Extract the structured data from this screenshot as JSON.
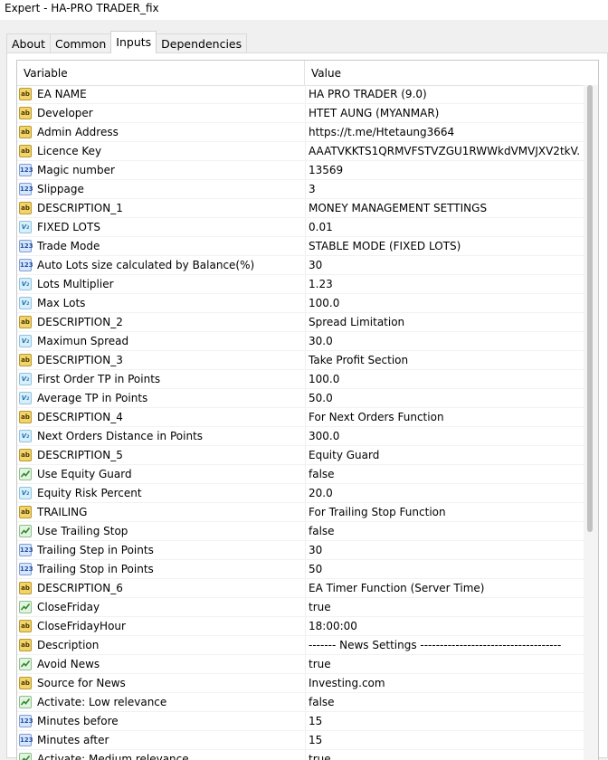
{
  "window": {
    "title": "Expert - HA-PRO TRADER_fix"
  },
  "tabs": [
    {
      "label": "About"
    },
    {
      "label": "Common"
    },
    {
      "label": "Inputs"
    },
    {
      "label": "Dependencies"
    }
  ],
  "active_tab": "Inputs",
  "table": {
    "columns": {
      "variable": "Variable",
      "value": "Value"
    },
    "rows": [
      {
        "type": "string",
        "icon": "string-icon",
        "variable": "EA NAME",
        "value": "HA PRO TRADER (9.0)"
      },
      {
        "type": "string",
        "icon": "string-icon",
        "variable": "Developer",
        "value": "HTET AUNG (MYANMAR)"
      },
      {
        "type": "string",
        "icon": "string-icon",
        "variable": "Admin Address",
        "value": "https://t.me/Htetaung3664"
      },
      {
        "type": "string",
        "icon": "string-icon",
        "variable": "Licence Key",
        "value": "AAATVKKTS1QRMVFSTVZGU1RWWkdVMVJXV2tkV..."
      },
      {
        "type": "int",
        "icon": "integer-icon",
        "variable": "Magic number",
        "value": "13569"
      },
      {
        "type": "int",
        "icon": "integer-icon",
        "variable": "Slippage",
        "value": "3"
      },
      {
        "type": "string",
        "icon": "string-icon",
        "variable": "DESCRIPTION_1",
        "value": "MONEY MANAGEMENT SETTINGS"
      },
      {
        "type": "double",
        "icon": "double-icon",
        "variable": "FIXED LOTS",
        "value": "0.01"
      },
      {
        "type": "int",
        "icon": "integer-icon",
        "variable": "Trade Mode",
        "value": "STABLE MODE (FIXED LOTS)"
      },
      {
        "type": "int",
        "icon": "integer-icon",
        "variable": "Auto Lots size calculated by Balance(%)",
        "value": "30"
      },
      {
        "type": "double",
        "icon": "double-icon",
        "variable": "Lots Multiplier",
        "value": "1.23"
      },
      {
        "type": "double",
        "icon": "double-icon",
        "variable": "Max Lots",
        "value": "100.0"
      },
      {
        "type": "string",
        "icon": "string-icon",
        "variable": "DESCRIPTION_2",
        "value": "Spread Limitation"
      },
      {
        "type": "double",
        "icon": "double-icon",
        "variable": "Maximun Spread",
        "value": "30.0"
      },
      {
        "type": "string",
        "icon": "string-icon",
        "variable": "DESCRIPTION_3",
        "value": "Take Profit Section"
      },
      {
        "type": "double",
        "icon": "double-icon",
        "variable": "First Order TP in Points",
        "value": "100.0"
      },
      {
        "type": "double",
        "icon": "double-icon",
        "variable": "Average TP in Points",
        "value": "50.0"
      },
      {
        "type": "string",
        "icon": "string-icon",
        "variable": "DESCRIPTION_4",
        "value": "For Next Orders Function"
      },
      {
        "type": "double",
        "icon": "double-icon",
        "variable": "Next Orders Distance in Points",
        "value": "300.0"
      },
      {
        "type": "string",
        "icon": "string-icon",
        "variable": "DESCRIPTION_5",
        "value": "Equity Guard"
      },
      {
        "type": "bool",
        "icon": "boolean-icon",
        "variable": "Use Equity Guard",
        "value": "false"
      },
      {
        "type": "double",
        "icon": "double-icon",
        "variable": "Equity Risk Percent",
        "value": "20.0"
      },
      {
        "type": "string",
        "icon": "string-icon",
        "variable": "TRAILING",
        "value": "For Trailing Stop Function"
      },
      {
        "type": "bool",
        "icon": "boolean-icon",
        "variable": "Use Trailing Stop",
        "value": "false"
      },
      {
        "type": "int",
        "icon": "integer-icon",
        "variable": "Trailing Step in Points",
        "value": "30"
      },
      {
        "type": "int",
        "icon": "integer-icon",
        "variable": "Trailing Stop in Points",
        "value": "50"
      },
      {
        "type": "string",
        "icon": "string-icon",
        "variable": "DESCRIPTION_6",
        "value": "EA Timer Function (Server Time)"
      },
      {
        "type": "bool",
        "icon": "boolean-icon",
        "variable": "CloseFriday",
        "value": "true"
      },
      {
        "type": "string",
        "icon": "string-icon",
        "variable": "CloseFridayHour",
        "value": "18:00:00"
      },
      {
        "type": "string",
        "icon": "string-icon",
        "variable": "Description",
        "value": "------- News Settings ------------------------------------"
      },
      {
        "type": "bool",
        "icon": "boolean-icon",
        "variable": "Avoid News",
        "value": "true"
      },
      {
        "type": "string",
        "icon": "string-icon",
        "variable": "Source for News",
        "value": "Investing.com"
      },
      {
        "type": "bool",
        "icon": "boolean-icon",
        "variable": "Activate: Low relevance",
        "value": "false"
      },
      {
        "type": "int",
        "icon": "integer-icon",
        "variable": "Minutes before",
        "value": "15"
      },
      {
        "type": "int",
        "icon": "integer-icon",
        "variable": "Minutes after",
        "value": "15"
      },
      {
        "type": "bool",
        "icon": "boolean-icon",
        "variable": "Activate: Medium relevance",
        "value": "true"
      }
    ]
  },
  "scrollbar": {
    "visible_fraction": 0.65
  }
}
